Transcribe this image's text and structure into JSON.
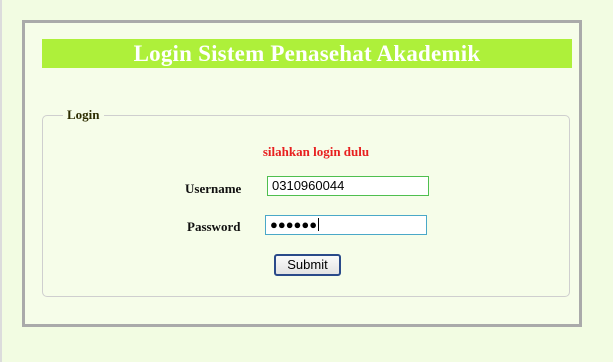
{
  "header": {
    "title": "Login Sistem Penasehat Akademik"
  },
  "login_form": {
    "legend": "Login",
    "message": "silahkan login dulu",
    "username_label": "Username",
    "username_value": "0310960044",
    "password_label": "Password",
    "password_masked": "●●●●●●",
    "submit_label": "Submit"
  },
  "colors": {
    "title_bar": "#aef03a",
    "message": "#e82020",
    "page_background": "#f2fce2"
  }
}
